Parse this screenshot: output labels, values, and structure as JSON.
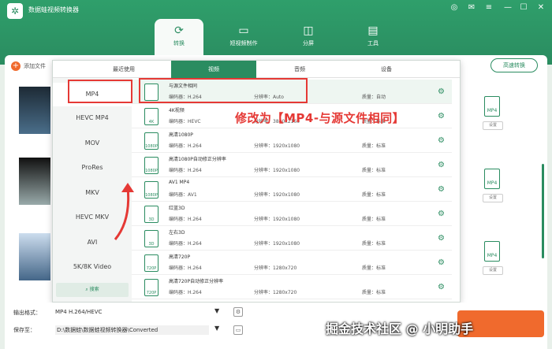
{
  "app": {
    "title": "数据蛙视频转换器"
  },
  "nav": [
    {
      "label": "转换"
    },
    {
      "label": "短视频制作"
    },
    {
      "label": "分屏"
    },
    {
      "label": "工具"
    }
  ],
  "toolbar": {
    "add_file": "添加文件",
    "fast_convert": "高速转换"
  },
  "panel": {
    "tabs": [
      "最近使用",
      "视频",
      "音频",
      "设备"
    ],
    "formats": [
      "MP4",
      "HEVC MP4",
      "MOV",
      "ProRes",
      "MKV",
      "HEVC MKV",
      "AVI",
      "5K/8K Video"
    ],
    "search": "搜索",
    "options": [
      {
        "name": "与源文件相同",
        "enc_label": "编码器：",
        "enc": "H.264",
        "res_label": "分辨率：",
        "res": "Auto",
        "q_label": "质量：",
        "q": "自动",
        "icon": ""
      },
      {
        "name": "4K视频",
        "enc_label": "编码器：",
        "enc": "HEVC",
        "res_label": "分辨率：",
        "res": "3840x2160",
        "q_label": "质量：",
        "q": "标准",
        "icon": "4K"
      },
      {
        "name": "高清1080P",
        "enc_label": "编码器：",
        "enc": "H.264",
        "res_label": "分辨率：",
        "res": "1920x1080",
        "q_label": "质量：",
        "q": "标准",
        "icon": "1080P"
      },
      {
        "name": "高清1080P自动修正分辨率",
        "enc_label": "编码器：",
        "enc": "H.264",
        "res_label": "分辨率：",
        "res": "1920x1080",
        "q_label": "质量：",
        "q": "标准",
        "icon": "1080P"
      },
      {
        "name": "AV1 MP4",
        "enc_label": "编码器：",
        "enc": "AV1",
        "res_label": "分辨率：",
        "res": "1920x1080",
        "q_label": "质量：",
        "q": "标准",
        "icon": "1080P"
      },
      {
        "name": "红蓝3D",
        "enc_label": "编码器：",
        "enc": "H.264",
        "res_label": "分辨率：",
        "res": "1920x1080",
        "q_label": "质量：",
        "q": "标准",
        "icon": "3D"
      },
      {
        "name": "左右3D",
        "enc_label": "编码器：",
        "enc": "H.264",
        "res_label": "分辨率：",
        "res": "1920x1080",
        "q_label": "质量：",
        "q": "标准",
        "icon": "3D"
      },
      {
        "name": "高清720P",
        "enc_label": "编码器：",
        "enc": "H.264",
        "res_label": "分辨率：",
        "res": "1280x720",
        "q_label": "质量：",
        "q": "标准",
        "icon": "720P"
      },
      {
        "name": "高清720P自动修正分辨率",
        "enc_label": "编码器：",
        "enc": "H.264",
        "res_label": "分辨率：",
        "res": "1280x720",
        "q_label": "质量：",
        "q": "标准",
        "icon": "720P"
      }
    ]
  },
  "annotation": "修改为【MP4-与源文件相同】",
  "files": [
    {
      "badge": "MP4",
      "setting": "设置"
    },
    {
      "badge": "MP4",
      "setting": "设置"
    },
    {
      "badge": "MP4",
      "setting": "设置"
    }
  ],
  "bottom": {
    "output_label": "输出格式：",
    "output_value": "MP4 H.264/HEVC",
    "save_label": "保存至：",
    "save_path": "D:\\数据蛙\\数据蛙视频转换器\\Converted"
  },
  "watermark": "掘金技术社区 @ 小明助手",
  "colors": {
    "brand": "#2a8c60",
    "accent": "#f06a2d",
    "highlight": "#e53935"
  }
}
